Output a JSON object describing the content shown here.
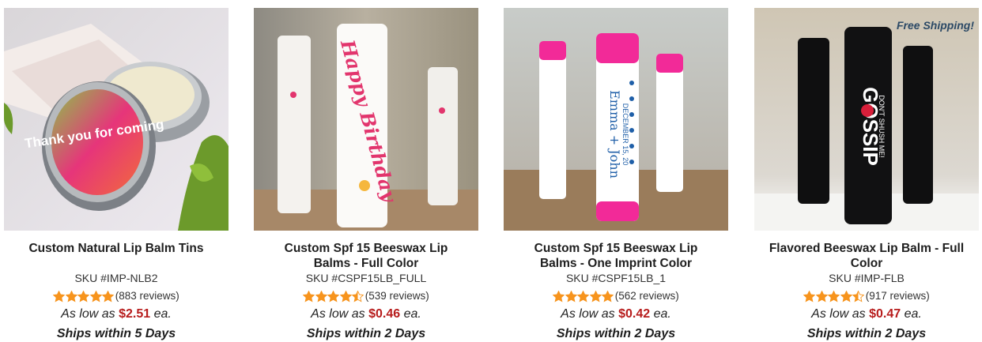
{
  "products": [
    {
      "title": "Custom Natural Lip Balm Tins",
      "sku": "SKU #IMP-NLB2",
      "rating": 5,
      "reviews": "(883 reviews)",
      "price_prefix": "As low as",
      "price": "$2.51",
      "price_suffix": "ea.",
      "ships": "Ships within 5 Days",
      "image_tin_label": "Thank you for coming",
      "badge": ""
    },
    {
      "title": "Custom Spf 15 Beeswax Lip Balms - Full Color",
      "sku": "SKU #CSPF15LB_FULL",
      "rating": 4.5,
      "reviews": "(539 reviews)",
      "price_prefix": "As low as",
      "price": "$0.46",
      "price_suffix": "ea.",
      "ships": "Ships within 2 Days",
      "image_tube_label": "Happy Birthday",
      "badge": ""
    },
    {
      "title": "Custom Spf 15 Beeswax Lip Balms - One Imprint Color",
      "sku": "SKU #CSPF15LB_1",
      "rating": 5,
      "reviews": "(562 reviews)",
      "price_prefix": "As low as",
      "price": "$0.42",
      "price_suffix": "ea.",
      "ships": "Ships within 2 Days",
      "image_tube_label": "Emma + John",
      "image_tube_sublabel": "DECEMBER 15, 20",
      "badge": ""
    },
    {
      "title": "Flavored Beeswax Lip Balm - Full Color",
      "sku": "SKU #IMP-FLB",
      "rating": 4.5,
      "reviews": "(917 reviews)",
      "price_prefix": "As low as",
      "price": "$0.47",
      "price_suffix": "ea.",
      "ships": "Ships within 2 Days",
      "image_tube_label": "GOSSIP",
      "image_tube_sublabel": "DON'T SHUSH ME!",
      "badge": "Free Shipping!"
    }
  ],
  "colors": {
    "star": "#f7941d",
    "price": "#b71c1c",
    "badge": "#2c4a66"
  }
}
